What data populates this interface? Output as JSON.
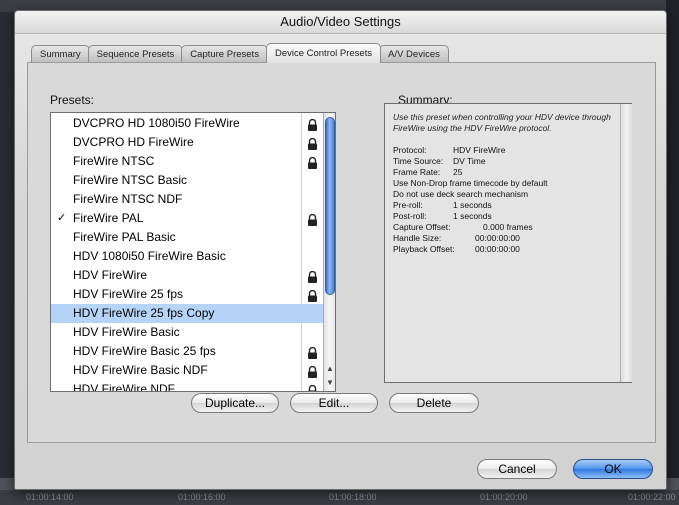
{
  "window": {
    "title": "Audio/Video Settings"
  },
  "tabs": [
    {
      "label": "Summary",
      "active": false
    },
    {
      "label": "Sequence Presets",
      "active": false
    },
    {
      "label": "Capture Presets",
      "active": false
    },
    {
      "label": "Device Control Presets",
      "active": true
    },
    {
      "label": "A/V Devices",
      "active": false
    }
  ],
  "presets": {
    "label": "Presets:",
    "items": [
      {
        "name": "DVCPRO HD 1080i50 FireWire",
        "locked": true,
        "checked": false,
        "selected": false
      },
      {
        "name": "DVCPRO HD FireWire",
        "locked": true,
        "checked": false,
        "selected": false
      },
      {
        "name": "FireWire NTSC",
        "locked": true,
        "checked": false,
        "selected": false
      },
      {
        "name": "FireWire NTSC Basic",
        "locked": false,
        "checked": false,
        "selected": false
      },
      {
        "name": "FireWire NTSC NDF",
        "locked": false,
        "checked": false,
        "selected": false
      },
      {
        "name": "FireWire PAL",
        "locked": true,
        "checked": true,
        "selected": false
      },
      {
        "name": "FireWire PAL Basic",
        "locked": false,
        "checked": false,
        "selected": false
      },
      {
        "name": "HDV 1080i50 FireWire Basic",
        "locked": false,
        "checked": false,
        "selected": false
      },
      {
        "name": "HDV FireWire",
        "locked": true,
        "checked": false,
        "selected": false
      },
      {
        "name": "HDV FireWire 25 fps",
        "locked": true,
        "checked": false,
        "selected": false
      },
      {
        "name": "HDV FireWire 25 fps Copy",
        "locked": false,
        "checked": false,
        "selected": true
      },
      {
        "name": "HDV FireWire Basic",
        "locked": false,
        "checked": false,
        "selected": false
      },
      {
        "name": "HDV FireWire Basic 25 fps",
        "locked": true,
        "checked": false,
        "selected": false
      },
      {
        "name": "HDV FireWire Basic NDF",
        "locked": true,
        "checked": false,
        "selected": false
      },
      {
        "name": "HDV FireWire NDF",
        "locked": true,
        "checked": false,
        "selected": false
      }
    ],
    "check_glyph": "✓"
  },
  "summary": {
    "label": "Summary:",
    "description": "Use this preset when controlling your HDV device through FireWire using the HDV FireWire protocol.",
    "fields": [
      {
        "key": "Protocol:",
        "value": "HDV FireWire"
      },
      {
        "key": "Time Source:",
        "value": "DV Time"
      },
      {
        "key": "Frame Rate:",
        "value": "25"
      },
      {
        "key": "Use Non-Drop frame timecode by default",
        "value": ""
      },
      {
        "key": "Do not use deck search mechanism",
        "value": ""
      },
      {
        "key": "Pre-roll:",
        "value": "1 seconds"
      },
      {
        "key": "Post-roll:",
        "value": "1 seconds"
      },
      {
        "key": "Capture Offset:",
        "value": "0.000 frames"
      },
      {
        "key": "Handle Size:",
        "value": "00:00:00:00"
      },
      {
        "key": "Playback Offset:",
        "value": "00:00:00:00"
      }
    ]
  },
  "buttons": {
    "duplicate": "Duplicate...",
    "edit": "Edit...",
    "delete": "Delete",
    "cancel": "Cancel",
    "ok": "OK"
  },
  "timeline": {
    "ticks": [
      "01:00:14:00",
      "01:00:16:00",
      "01:00:18:00",
      "01:00:20:00",
      "01:00:22:00"
    ]
  },
  "colors": {
    "selection": "#b5d4f7",
    "primary_button": "#3d84e6",
    "scroll_thumb": "#4d82d8"
  }
}
